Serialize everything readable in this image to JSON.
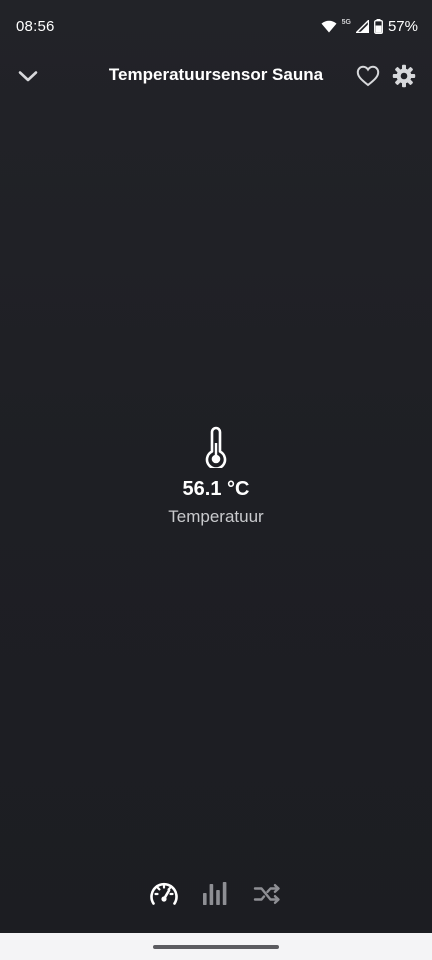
{
  "status_bar": {
    "time": "08:56",
    "network_badge": "5G",
    "battery_percent": "57%",
    "icons": [
      "wifi-icon",
      "cell-signal-icon",
      "battery-icon"
    ]
  },
  "app_bar": {
    "title": "Temperatuursensor Sauna",
    "back_icon": "chevron-down-icon",
    "favorite_icon": "heart-outline-icon",
    "settings_icon": "gear-icon"
  },
  "sensor": {
    "icon": "thermometer-icon",
    "value": "56.1 °C",
    "label": "Temperatuur"
  },
  "tabs": [
    {
      "icon": "speedometer-icon",
      "active": true
    },
    {
      "icon": "bar-chart-icon",
      "active": false
    },
    {
      "icon": "shuffle-icon",
      "active": false
    }
  ],
  "colors": {
    "background": "#1f2025",
    "text_primary": "#ffffff",
    "text_secondary": "#c9cacd",
    "icon_inactive": "#8e8f94",
    "nav_bar": "#f4f4f6"
  }
}
